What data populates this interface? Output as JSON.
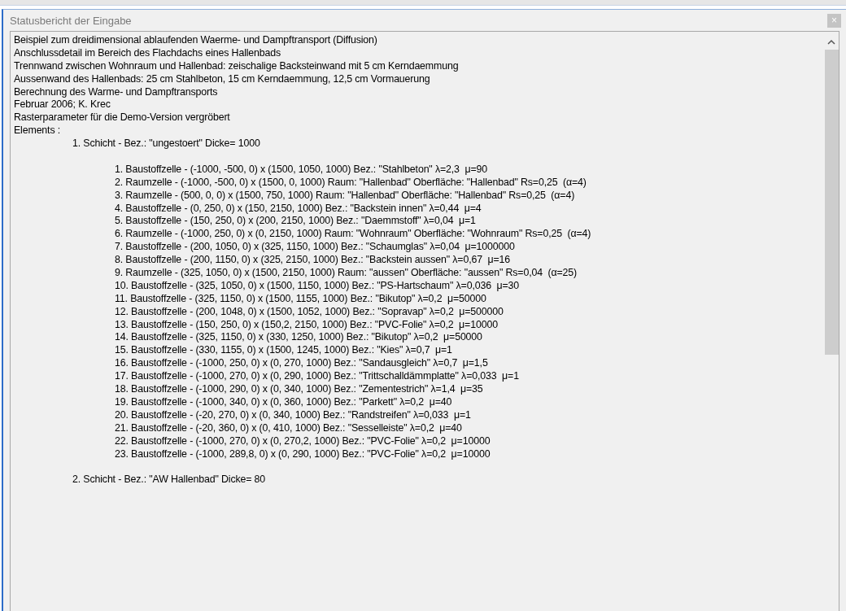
{
  "window": {
    "title": "Statusbericht der Eingabe",
    "close": "×"
  },
  "header_lines": [
    "Beispiel zum dreidimensional ablaufenden Waerme- und Dampftransport (Diffusion)",
    "Anschlussdetail im Bereich des Flachdachs eines Hallenbads",
    "Trennwand zwischen Wohnraum und Hallenbad: zeischalige Backsteinwand mit 5 cm Kerndaemmung",
    "Aussenwand des Hallenbads: 25 cm Stahlbeton, 15 cm Kerndaemmung, 12,5 cm Vormauerung",
    "Berechnung des Warme- und Dampftransports",
    "Februar 2006; K. Krec",
    "Rasterparameter für die Demo-Version vergröbert",
    "Elements :"
  ],
  "layers": [
    {
      "title": "1. Schicht - Bez.: \"ungestoert\" Dicke= 1000",
      "cells": [
        "1. Baustoffzelle - (-1000, -500, 0) x (1500, 1050, 1000) Bez.: \"Stahlbeton\" λ=2,3  μ=90",
        "2. Raumzelle - (-1000, -500, 0) x (1500, 0, 1000) Raum: \"Hallenbad\" Oberfläche: \"Hallenbad\" Rs=0,25  (α=4)",
        "3. Raumzelle - (500, 0, 0) x (1500, 750, 1000) Raum: \"Hallenbad\" Oberfläche: \"Hallenbad\" Rs=0,25  (α=4)",
        "4. Baustoffzelle - (0, 250, 0) x (150, 2150, 1000) Bez.: \"Backstein innen\" λ=0,44  μ=4",
        "5. Baustoffzelle - (150, 250, 0) x (200, 2150, 1000) Bez.: \"Daemmstoff\" λ=0,04  μ=1",
        "6. Raumzelle - (-1000, 250, 0) x (0, 2150, 1000) Raum: \"Wohnraum\" Oberfläche: \"Wohnraum\" Rs=0,25  (α=4)",
        "7. Baustoffzelle - (200, 1050, 0) x (325, 1150, 1000) Bez.: \"Schaumglas\" λ=0,04  μ=1000000",
        "8. Baustoffzelle - (200, 1150, 0) x (325, 2150, 1000) Bez.: \"Backstein aussen\" λ=0,67  μ=16",
        "9. Raumzelle - (325, 1050, 0) x (1500, 2150, 1000) Raum: \"aussen\" Oberfläche: \"aussen\" Rs=0,04  (α=25)",
        "10. Baustoffzelle - (325, 1050, 0) x (1500, 1150, 1000) Bez.: \"PS-Hartschaum\" λ=0,036  μ=30",
        "11. Baustoffzelle - (325, 1150, 0) x (1500, 1155, 1000) Bez.: \"Bikutop\" λ=0,2  μ=50000",
        "12. Baustoffzelle - (200, 1048, 0) x (1500, 1052, 1000) Bez.: \"Sopravap\" λ=0,2  μ=500000",
        "13. Baustoffzelle - (150, 250, 0) x (150,2, 2150, 1000) Bez.: \"PVC-Folie\" λ=0,2  μ=10000",
        "14. Baustoffzelle - (325, 1150, 0) x (330, 1250, 1000) Bez.: \"Bikutop\" λ=0,2  μ=50000",
        "15. Baustoffzelle - (330, 1155, 0) x (1500, 1245, 1000) Bez.: \"Kies\" λ=0,7  μ=1",
        "16. Baustoffzelle - (-1000, 250, 0) x (0, 270, 1000) Bez.: \"Sandausgleich\" λ=0,7  μ=1,5",
        "17. Baustoffzelle - (-1000, 270, 0) x (0, 290, 1000) Bez.: \"Trittschalldämmplatte\" λ=0,033  μ=1",
        "18. Baustoffzelle - (-1000, 290, 0) x (0, 340, 1000) Bez.: \"Zementestrich\" λ=1,4  μ=35",
        "19. Baustoffzelle - (-1000, 340, 0) x (0, 360, 1000) Bez.: \"Parkett\" λ=0,2  μ=40",
        "20. Baustoffzelle - (-20, 270, 0) x (0, 340, 1000) Bez.: \"Randstreifen\" λ=0,033  μ=1",
        "21. Baustoffzelle - (-20, 360, 0) x (0, 410, 1000) Bez.: \"Sesselleiste\" λ=0,2  μ=40",
        "22. Baustoffzelle - (-1000, 270, 0) x (0, 270,2, 1000) Bez.: \"PVC-Folie\" λ=0,2  μ=10000",
        "23. Baustoffzelle - (-1000, 289,8, 0) x (0, 290, 1000) Bez.: \"PVC-Folie\" λ=0,2  μ=10000"
      ]
    },
    {
      "title": "2. Schicht - Bez.: \"AW Hallenbad\" Dicke= 80"
    }
  ]
}
